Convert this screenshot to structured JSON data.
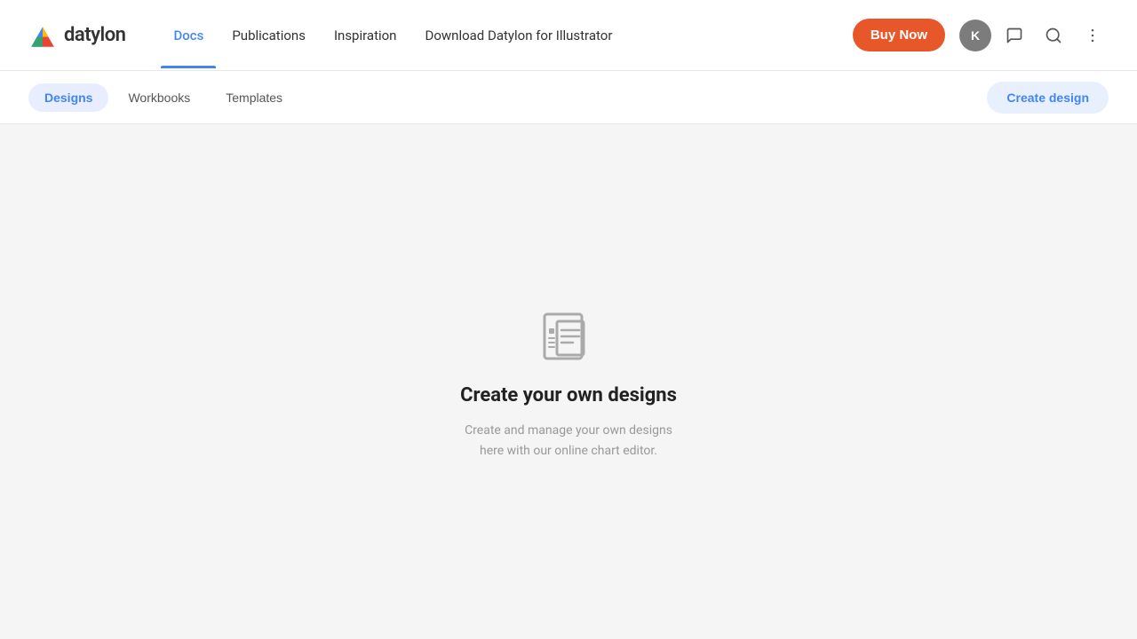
{
  "header": {
    "logo_text": "datylon",
    "nav_items": [
      {
        "id": "docs",
        "label": "Docs",
        "active": true
      },
      {
        "id": "publications",
        "label": "Publications",
        "active": false
      },
      {
        "id": "inspiration",
        "label": "Inspiration",
        "active": false
      },
      {
        "id": "download",
        "label": "Download Datylon for Illustrator",
        "active": false
      }
    ],
    "buy_now_label": "Buy Now",
    "avatar_letter": "K",
    "chat_icon": "💬",
    "search_icon": "🔍",
    "more_icon": "⋮"
  },
  "sub_header": {
    "tabs": [
      {
        "id": "designs",
        "label": "Designs",
        "active": true
      },
      {
        "id": "workbooks",
        "label": "Workbooks",
        "active": false
      },
      {
        "id": "templates",
        "label": "Templates",
        "active": false
      }
    ],
    "create_design_label": "Create design"
  },
  "empty_state": {
    "title": "Create your own designs",
    "description": "Create and manage your own designs here with our online chart editor.",
    "icon_label": "designs-empty-icon"
  },
  "colors": {
    "accent_blue": "#4285f4",
    "accent_orange": "#e8572a",
    "tab_active_bg": "#e8eeff",
    "text_primary": "#222222",
    "text_secondary": "#999999",
    "bg_main": "#f5f5f5",
    "bg_white": "#ffffff",
    "icon_gray": "#aaaaaa"
  }
}
